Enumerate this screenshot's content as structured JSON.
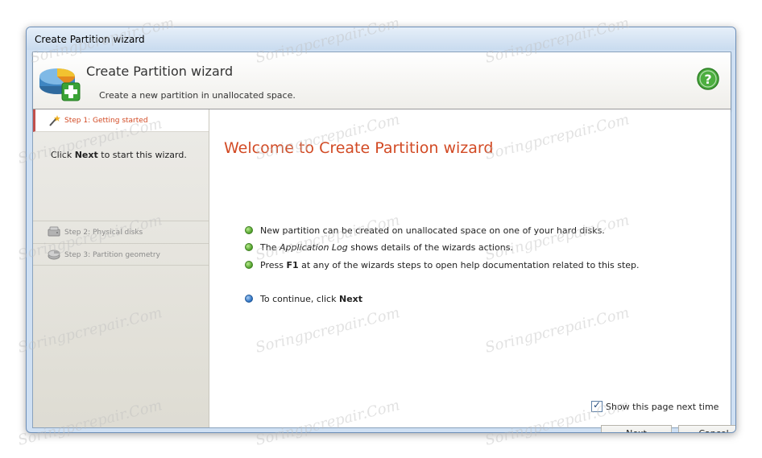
{
  "window": {
    "title": "Create Partition wizard"
  },
  "header": {
    "title": "Create Partition wizard",
    "subtitle": "Create a new partition in unallocated space.",
    "logo_icon": "disk-partition-add-icon",
    "help_icon": "help-icon"
  },
  "sidebar": {
    "steps": [
      {
        "label": "Step 1: Getting started",
        "icon": "wand-icon",
        "state": "current"
      },
      {
        "label": "Step 2: Physical disks",
        "icon": "disk-icon",
        "state": "disabled"
      },
      {
        "label": "Step 3: Partition geometry",
        "icon": "disk-geometry-icon",
        "state": "disabled"
      }
    ],
    "hint_prefix": "Click",
    "hint_bold": "Next",
    "hint_suffix": "to start this wizard."
  },
  "main": {
    "title": "Welcome to Create Partition wizard",
    "bullets": [
      {
        "parts": [
          "New partition can be created on unallocated space on one of your hard disks."
        ]
      },
      {
        "parts": [
          "The ",
          "Application Log",
          " shows details of the wizards actions."
        ]
      },
      {
        "parts": [
          "Press ",
          "F1",
          " at any of the wizards steps to open help documentation related to this step."
        ]
      }
    ],
    "continue_prefix": "To continue, click",
    "continue_bold": "Next"
  },
  "footer": {
    "show_next_time_label": "Show this page next time",
    "show_next_time_checked": true,
    "next_label": "Next",
    "cancel_label": "Cancel"
  },
  "watermark": "Soringpcrepair.Com",
  "colors": {
    "accent": "#d24a24",
    "step_marker": "#c0504d",
    "bullet_green": "#4f9f2a",
    "bullet_blue": "#2a6fc0"
  }
}
